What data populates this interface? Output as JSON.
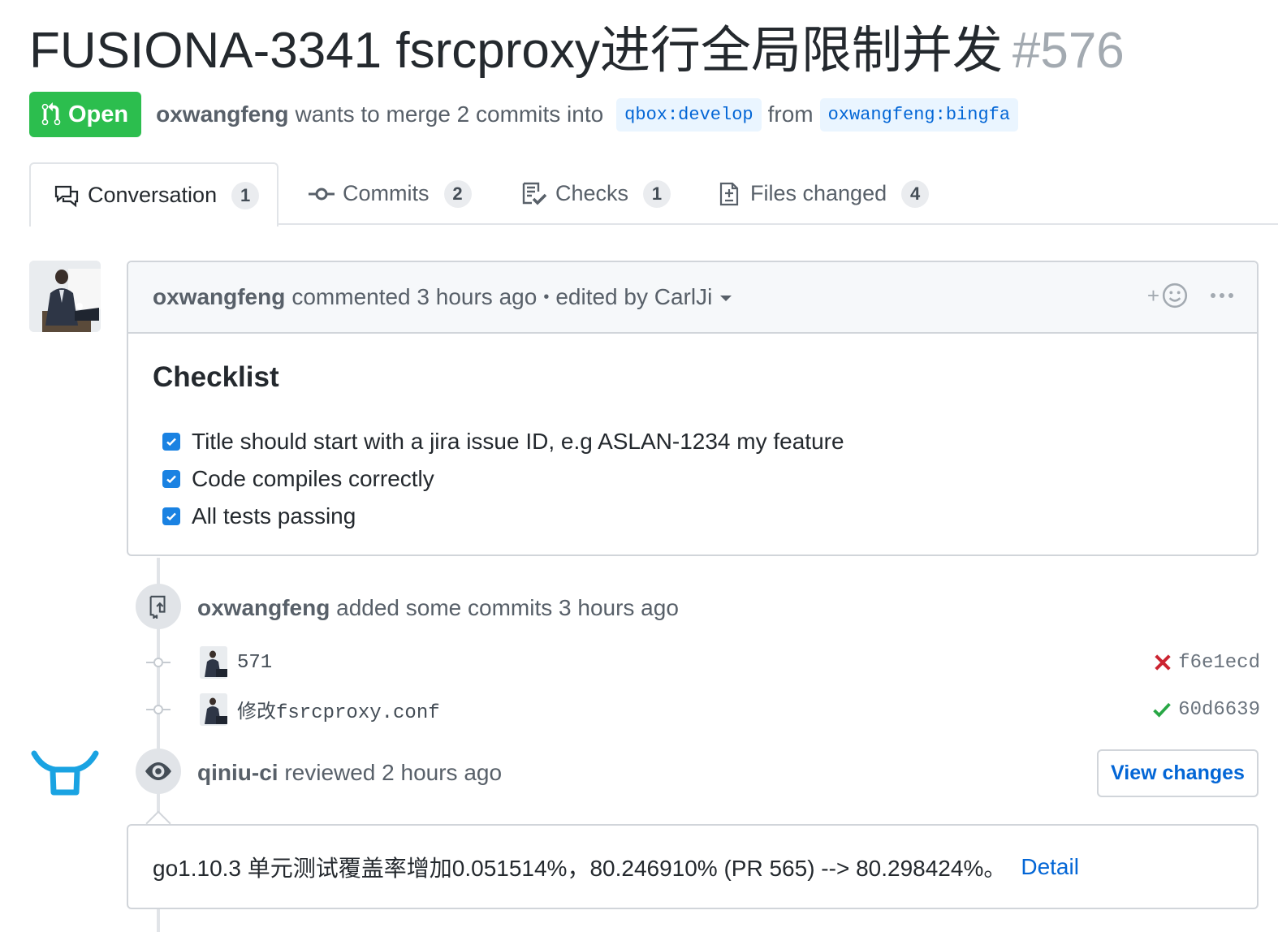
{
  "pr": {
    "title": "FUSIONA-3341 fsrcproxy进行全局限制并发",
    "number": "#576",
    "state": "Open",
    "author": "oxwangfeng",
    "merge_text": "wants to merge 2 commits into",
    "base_branch": "qbox:develop",
    "from_text": "from",
    "head_branch": "oxwangfeng:bingfa"
  },
  "tabs": [
    {
      "label": "Conversation",
      "count": "1",
      "icon": "comment-discussion-icon"
    },
    {
      "label": "Commits",
      "count": "2",
      "icon": "git-commit-icon"
    },
    {
      "label": "Checks",
      "count": "1",
      "icon": "checklist-icon"
    },
    {
      "label": "Files changed",
      "count": "4",
      "icon": "file-diff-icon"
    }
  ],
  "comment": {
    "author": "oxwangfeng",
    "meta": "commented 3 hours ago",
    "separator": "•",
    "edited": "edited by CarlJi",
    "add_reaction": "+",
    "heading": "Checklist",
    "tasks": [
      "Title should start with a jira issue ID, e.g ASLAN-1234 my feature",
      "Code compiles correctly",
      "All tests passing"
    ]
  },
  "commits_event": {
    "author": "oxwangfeng",
    "text": "added some commits 3 hours ago",
    "commits": [
      {
        "message": "571",
        "sha": "f6e1ecd",
        "status": "failure",
        "status_color": "#cb2431"
      },
      {
        "message": "修改fsrcproxy.conf",
        "sha": "60d6639",
        "status": "success",
        "status_color": "#28a745"
      }
    ]
  },
  "review": {
    "author": "qiniu-ci",
    "text": "reviewed 2 hours ago",
    "view_changes": "View changes",
    "body": "go1.10.3 单元测试覆盖率增加0.051514%，80.246910% (PR 565) --> 80.298424%。",
    "link": "Detail"
  },
  "colors": {
    "open_green": "#2cbe4e",
    "link_blue": "#0366d6",
    "qiniu_logo": "#1aa3e2"
  }
}
